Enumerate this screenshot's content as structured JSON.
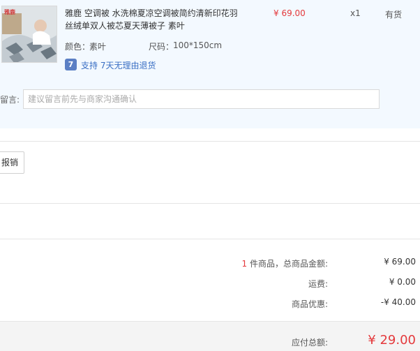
{
  "product": {
    "thumb_logo": "雅鹿",
    "title": "雅鹿 空调被 水洗棉夏凉空调被简约清新印花羽丝绒单双人被芯夏天薄被子 素叶",
    "price": "¥ 69.00",
    "quantity": "x1",
    "stock": "有货",
    "color_label": "颜色：",
    "color_value": "素叶",
    "size_label": "尺码：",
    "size_value": "100*150cm",
    "return_icon_glyph": "7",
    "return_policy": "支持 7天无理由退货"
  },
  "note": {
    "label": "留言:",
    "placeholder": "建议留言前先与商家沟通确认"
  },
  "reimburse_button": "报销",
  "summary": {
    "count": "1",
    "count_suffix": " 件商品，总商品金额:",
    "goods_total": "¥ 69.00",
    "shipping_label": "运费:",
    "shipping": "¥ 0.00",
    "discount_label": "商品优惠:",
    "discount": "-¥ 40.00",
    "payable_label": "应付总额:",
    "payable": "¥ 29.00"
  },
  "colors": {
    "accent_red": "#e4393c",
    "link_blue": "#3a6fc4",
    "product_bg": "#f3f9ff"
  }
}
